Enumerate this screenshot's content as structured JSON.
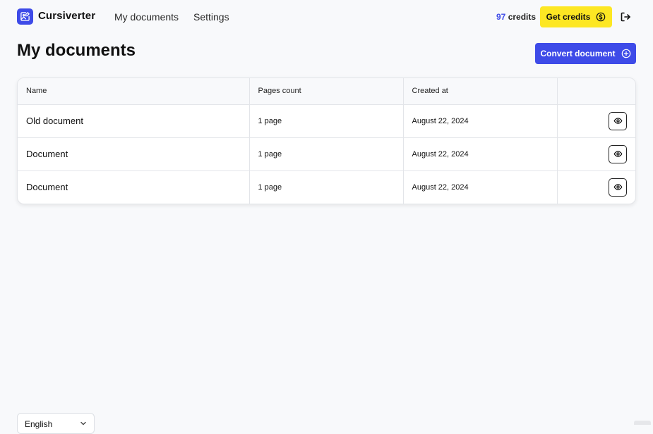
{
  "header": {
    "brand": "Cursiverter",
    "nav": {
      "my_documents": "My documents",
      "settings": "Settings"
    },
    "credits": {
      "count": "97",
      "label": "credits"
    },
    "get_credits_label": "Get credits"
  },
  "main": {
    "title": "My documents",
    "convert_label": "Convert document",
    "table": {
      "columns": {
        "name": "Name",
        "pages": "Pages count",
        "created": "Created at"
      },
      "rows": [
        {
          "name": "Old document",
          "pages": "1 page",
          "created": "August 22, 2024"
        },
        {
          "name": "Document",
          "pages": "1 page",
          "created": "August 22, 2024"
        },
        {
          "name": "Document",
          "pages": "1 page",
          "created": "August 22, 2024"
        }
      ]
    }
  },
  "footer": {
    "language": "English"
  },
  "colors": {
    "accent": "#3e4be8",
    "highlight": "#fde723",
    "background": "#f8f9fb"
  },
  "icons": {
    "logo": "document-image-icon",
    "get_credits": "dollar-coin-icon",
    "logout": "logout-icon",
    "convert": "plus-circle-icon",
    "view": "eye-icon",
    "language": "chevron-down-icon"
  }
}
